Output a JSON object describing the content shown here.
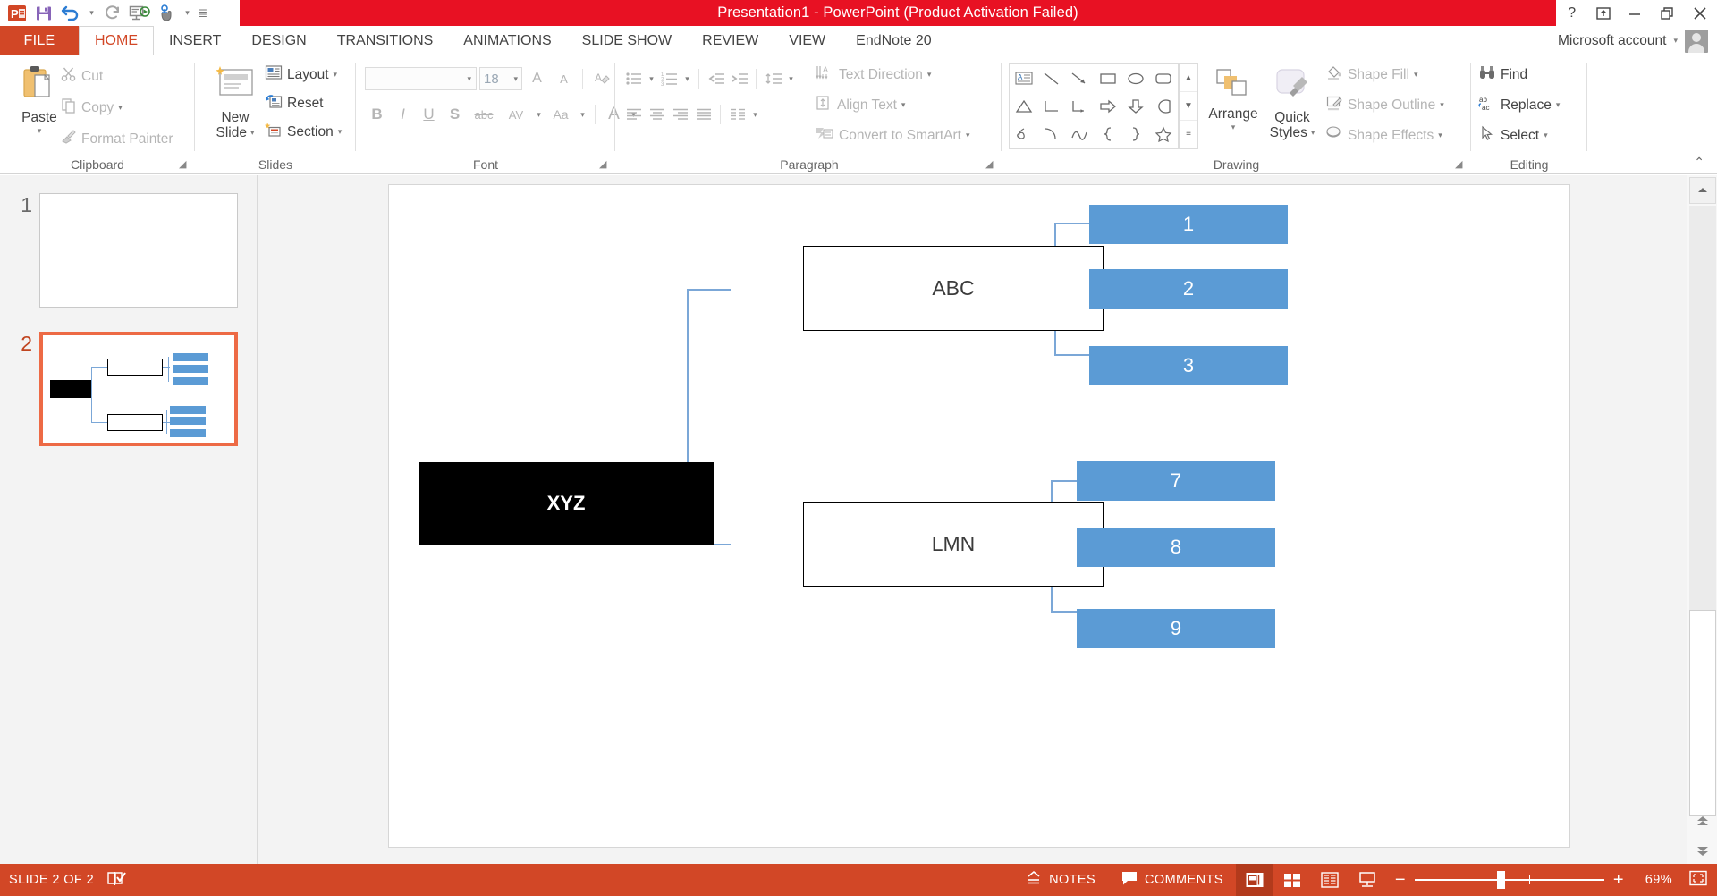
{
  "window": {
    "title": "Presentation1  -  PowerPoint (Product Activation Failed)",
    "help_icon": "?",
    "ribbon_display_icon": "ribbon-display-options-icon",
    "minimize_icon": "—",
    "restore_icon": "❐",
    "close_icon": "✕",
    "account_label": "Microsoft account",
    "account_caret": "▾"
  },
  "quick_access": {
    "items": [
      {
        "name": "powerpoint-logo-icon",
        "label": "P"
      },
      {
        "name": "save-icon",
        "label": "Save"
      },
      {
        "name": "undo-icon",
        "label": "Undo"
      },
      {
        "name": "undo-caret-icon",
        "label": "▾"
      },
      {
        "name": "redo-icon",
        "label": "Redo"
      },
      {
        "name": "start-slideshow-icon",
        "label": "Start From Beginning"
      },
      {
        "name": "touch-mode-icon",
        "label": "Touch/Mouse Mode"
      },
      {
        "name": "touch-caret-icon",
        "label": "▾"
      },
      {
        "name": "customize-qat-icon",
        "label": "≡"
      }
    ]
  },
  "tabs": {
    "file": "FILE",
    "items": [
      {
        "label": "HOME",
        "active": true
      },
      {
        "label": "INSERT",
        "active": false
      },
      {
        "label": "DESIGN",
        "active": false
      },
      {
        "label": "TRANSITIONS",
        "active": false
      },
      {
        "label": "ANIMATIONS",
        "active": false
      },
      {
        "label": "SLIDE SHOW",
        "active": false
      },
      {
        "label": "REVIEW",
        "active": false
      },
      {
        "label": "VIEW",
        "active": false
      },
      {
        "label": "EndNote 20",
        "active": false
      }
    ]
  },
  "ribbon": {
    "clipboard": {
      "group_label": "Clipboard",
      "paste_label": "Paste",
      "paste_caret": "▾",
      "cut_label": "Cut",
      "copy_label": "Copy",
      "copy_caret": "▾",
      "format_painter_label": "Format Painter"
    },
    "slides": {
      "group_label": "Slides",
      "new_slide_line1": "New",
      "new_slide_line2": "Slide",
      "new_slide_caret": "▾",
      "layout_label": "Layout",
      "layout_caret": "▾",
      "reset_label": "Reset",
      "section_label": "Section",
      "section_caret": "▾"
    },
    "font": {
      "group_label": "Font",
      "font_name_value": "",
      "font_name_caret": "▾",
      "font_size_value": "18",
      "font_size_caret": "▾",
      "grow_font": "A",
      "shrink_font": "A",
      "clear_formatting": "A",
      "bold": "B",
      "italic": "I",
      "underline": "U",
      "shadow": "S",
      "strikethrough": "abc",
      "char_spacing": "AV",
      "change_case": "Aa",
      "font_color": "A",
      "caret": "▾"
    },
    "paragraph": {
      "group_label": "Paragraph",
      "text_direction_label": "Text Direction",
      "align_text_label": "Align Text",
      "convert_smartart_label": "Convert to SmartArt",
      "caret": "▾"
    },
    "drawing": {
      "group_label": "Drawing",
      "arrange_label": "Arrange",
      "arrange_caret": "▾",
      "quick_styles_line1": "Quick",
      "quick_styles_line2": "Styles",
      "quick_styles_caret": "▾",
      "shape_fill_label": "Shape Fill",
      "shape_outline_label": "Shape Outline",
      "shape_effects_label": "Shape Effects",
      "caret": "▾",
      "shapes": [
        "textbox",
        "line",
        "arrow",
        "rectangle",
        "oval",
        "rounded-rectangle",
        "triangle",
        "elbow-connector",
        "elbow-arrow-connector",
        "right-arrow",
        "down-arrow",
        "pie",
        "scribble",
        "arc",
        "curve",
        "left-brace",
        "right-brace",
        "star"
      ],
      "scroll_up": "▲",
      "scroll_down": "▼",
      "scroll_more": "≡"
    },
    "editing": {
      "group_label": "Editing",
      "find_label": "Find",
      "replace_label": "Replace",
      "select_label": "Select",
      "caret": "▾"
    },
    "collapse_icon": "⌃"
  },
  "slide_panel": {
    "thumbnails": [
      {
        "number": "1",
        "selected": false
      },
      {
        "number": "2",
        "selected": true
      }
    ]
  },
  "slide": {
    "nodes": [
      {
        "id": "xyz",
        "label": "XYZ",
        "style": "black"
      },
      {
        "id": "abc",
        "label": "ABC",
        "style": "white"
      },
      {
        "id": "lmn",
        "label": "LMN",
        "style": "white"
      },
      {
        "id": "n1",
        "label": "1",
        "style": "blue"
      },
      {
        "id": "n2",
        "label": "2",
        "style": "blue"
      },
      {
        "id": "n3",
        "label": "3",
        "style": "blue"
      },
      {
        "id": "n7",
        "label": "7",
        "style": "blue"
      },
      {
        "id": "n8",
        "label": "8",
        "style": "blue"
      },
      {
        "id": "n9",
        "label": "9",
        "style": "blue"
      }
    ],
    "colors": {
      "blue_fill": "#5B9BD5",
      "black_fill": "#000000",
      "connector": "#7BA7D7",
      "outline": "#000000"
    }
  },
  "status_bar": {
    "slide_label": "SLIDE 2 OF 2",
    "language_icon": "spell-check-icon",
    "notes_label": "NOTES",
    "comments_label": "COMMENTS",
    "views": [
      {
        "name": "normal-view-button",
        "active": true
      },
      {
        "name": "slide-sorter-view-button",
        "active": false
      },
      {
        "name": "reading-view-button",
        "active": false
      },
      {
        "name": "slideshow-view-button",
        "active": false
      }
    ],
    "zoom_out": "−",
    "zoom_in": "+",
    "zoom_value": "69%",
    "fit_to_window_icon": "fit-slide-to-window-icon"
  },
  "scrollbar": {
    "up_icon": "▲",
    "down_icon": "▼",
    "prev_slide_icon": "▲",
    "next_slide_icon": "▼"
  }
}
